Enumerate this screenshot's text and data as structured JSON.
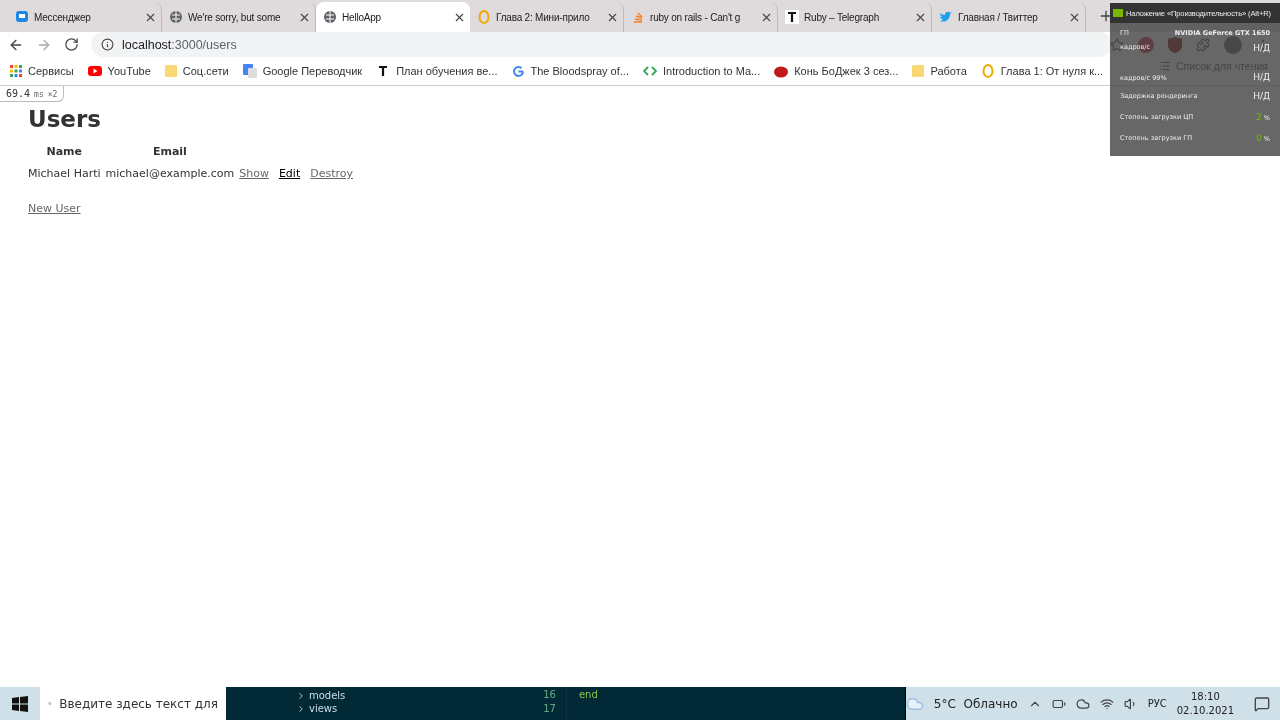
{
  "tabs": [
    {
      "title": "Мессенджер",
      "kind": "chat",
      "selected": false
    },
    {
      "title": "We're sorry, but some",
      "kind": "globe",
      "selected": false
    },
    {
      "title": "HelloApp",
      "kind": "globe",
      "selected": true
    },
    {
      "title": "Глава 2: Мини-прило",
      "kind": "ring",
      "selected": false
    },
    {
      "title": "ruby on rails - Can't g",
      "kind": "stack",
      "selected": false
    },
    {
      "title": "Ruby – Telegraph",
      "kind": "letter",
      "selected": false
    },
    {
      "title": "Главная / Твиттер",
      "kind": "bird",
      "selected": false
    }
  ],
  "address": {
    "host": "localhost",
    "rest": ":3000/users"
  },
  "reading_list": "Список для чтения",
  "bookmarks": [
    {
      "label": "Сервисы",
      "kind": "apps"
    },
    {
      "label": "YouTube",
      "kind": "play"
    },
    {
      "label": "Соц.сети",
      "kind": "folder"
    },
    {
      "label": "Google Переводчик",
      "kind": "translate"
    },
    {
      "label": "План обучения ве...",
      "kind": "letter"
    },
    {
      "label": "The Bloodspray of...",
      "kind": "g"
    },
    {
      "label": "Introduction to Ma...",
      "kind": "code"
    },
    {
      "label": "Конь БоДжек 3 сез...",
      "kind": "red"
    },
    {
      "label": "Работа",
      "kind": "folder"
    },
    {
      "label": "Глава 1: От нуля к...",
      "kind": "ring"
    }
  ],
  "overlay": {
    "title": "Наложение «Производительность» (Alt+R)",
    "rows": [
      {
        "label": "ГП",
        "value": "NVIDIA GeForce GTX 1650",
        "kind": "header"
      },
      {
        "label": "кадров/с",
        "value": "Н/Д",
        "kind": "plain"
      },
      {
        "label": "кадров/с 99%",
        "value": "Н/Д",
        "kind": "plain"
      },
      {
        "label": "Задержка рендеринга",
        "value": "Н/Д",
        "kind": "plain"
      },
      {
        "label": "Степень загрузки ЦП",
        "value": "2",
        "unit": "%",
        "kind": "percent"
      },
      {
        "label": "Степень загрузки ГП",
        "value": "0",
        "unit": "%",
        "kind": "percent"
      }
    ]
  },
  "profiler": {
    "time": "69.4",
    "unit": "ms",
    "count": "×2"
  },
  "page": {
    "heading": "Users",
    "columns": [
      "Name",
      "Email"
    ],
    "rows": [
      {
        "name": "Michael Harti",
        "email": "michael@example.com",
        "actions": [
          {
            "label": "Show",
            "visited": true
          },
          {
            "label": "Edit",
            "visited": false
          },
          {
            "label": "Destroy",
            "visited": true
          }
        ]
      }
    ],
    "new_link": {
      "label": "New User",
      "visited": true
    }
  },
  "taskbar": {
    "search_placeholder": "Введите здесь текст для",
    "editor": {
      "folders": [
        "models",
        "views"
      ],
      "line_numbers": [
        "16",
        "17"
      ],
      "code": "end"
    },
    "weather": "5°C  Облачно",
    "language": "РУС",
    "time": "18:10",
    "date": "02.10.2021"
  }
}
